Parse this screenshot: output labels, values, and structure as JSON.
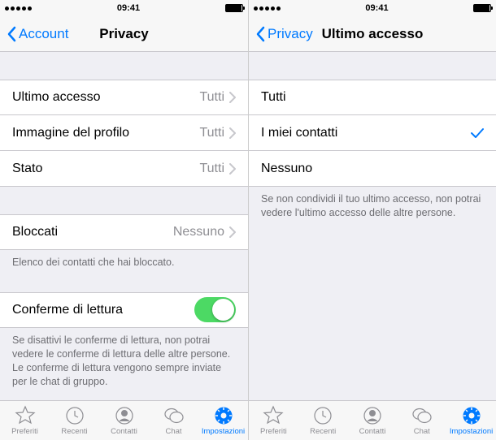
{
  "left": {
    "status": {
      "time": "09:41"
    },
    "nav": {
      "back": "Account",
      "title": "Privacy"
    },
    "rows": [
      {
        "label": "Ultimo accesso",
        "value": "Tutti"
      },
      {
        "label": "Immagine del profilo",
        "value": "Tutti"
      },
      {
        "label": "Stato",
        "value": "Tutti"
      }
    ],
    "blocked": {
      "label": "Bloccati",
      "value": "Nessuno"
    },
    "blocked_footer": "Elenco dei contatti che hai bloccato.",
    "read_receipts": {
      "label": "Conferme di lettura",
      "on": true
    },
    "read_receipts_footer": "Se disattivi le conferme di lettura, non potrai vedere le conferme di lettura delle altre persone. Le conferme di lettura vengono sempre inviate per le chat di gruppo."
  },
  "right": {
    "status": {
      "time": "09:41"
    },
    "nav": {
      "back": "Privacy",
      "title": "Ultimo accesso"
    },
    "options": [
      {
        "label": "Tutti",
        "selected": false
      },
      {
        "label": "I miei contatti",
        "selected": true
      },
      {
        "label": "Nessuno",
        "selected": false
      }
    ],
    "footer": "Se non condividi il tuo ultimo accesso, non potrai vedere l'ultimo accesso delle altre persone."
  },
  "tabs": [
    {
      "label": "Preferiti",
      "icon": "star-icon"
    },
    {
      "label": "Recenti",
      "icon": "clock-icon"
    },
    {
      "label": "Contatti",
      "icon": "contact-icon"
    },
    {
      "label": "Chat",
      "icon": "chat-icon"
    },
    {
      "label": "Impostazioni",
      "icon": "gear-icon",
      "active": true
    }
  ]
}
